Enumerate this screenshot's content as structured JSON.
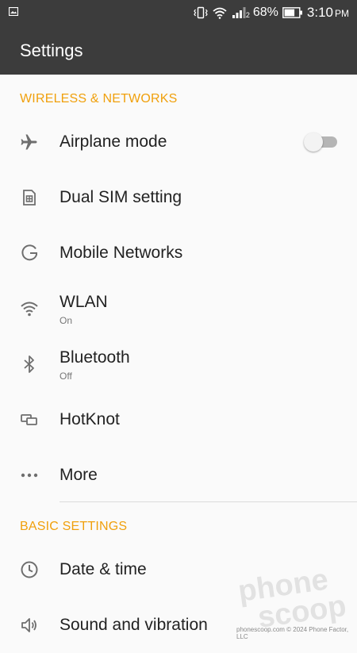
{
  "status": {
    "battery": "68%",
    "time": "3:10",
    "ampm": "PM",
    "sim_slot": "2"
  },
  "appbar": {
    "title": "Settings"
  },
  "sections": [
    {
      "header": "WIRELESS & NETWORKS"
    },
    {
      "header": "BASIC SETTINGS"
    }
  ],
  "items": {
    "airplane": {
      "title": "Airplane mode",
      "icon": "airplane-icon",
      "toggle_on": false
    },
    "dual_sim": {
      "title": "Dual SIM setting",
      "icon": "dual-sim-icon"
    },
    "mobile": {
      "title": "Mobile Networks",
      "icon": "g-icon"
    },
    "wlan": {
      "title": "WLAN",
      "summary": "On",
      "icon": "wifi-icon"
    },
    "bluetooth": {
      "title": "Bluetooth",
      "summary": "Off",
      "icon": "bluetooth-icon"
    },
    "hotknot": {
      "title": "HotKnot",
      "icon": "hotknot-icon"
    },
    "more": {
      "title": "More",
      "icon": "more-dots-icon"
    },
    "date_time": {
      "title": "Date & time",
      "icon": "clock-icon"
    },
    "sound": {
      "title": "Sound and vibration",
      "icon": "speaker-icon"
    }
  },
  "watermark": {
    "line1": "phone",
    "line2": "scoop",
    "credit": "phonescoop.com © 2024 Phone Factor, LLC"
  },
  "colors": {
    "accent": "#f0a00c",
    "bar": "#3c3c3c",
    "background": "#fafafa"
  }
}
